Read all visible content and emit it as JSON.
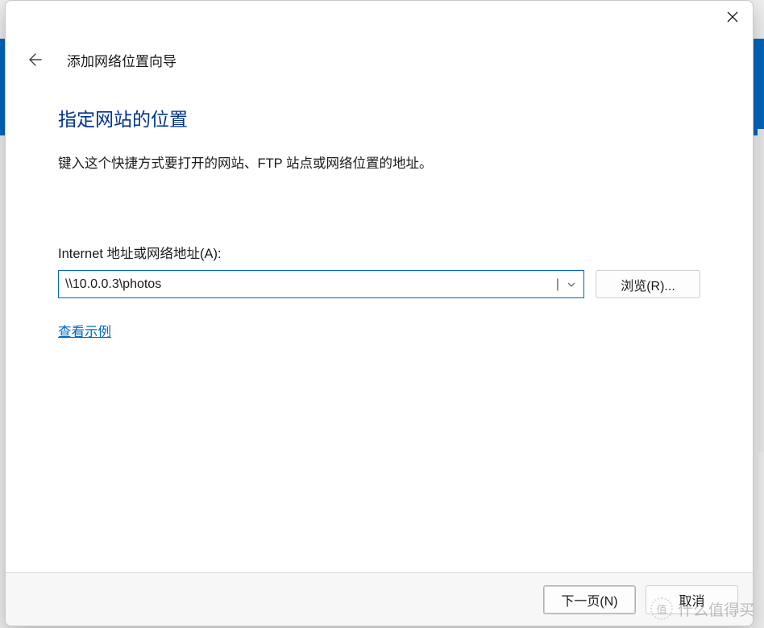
{
  "wizard": {
    "title": "添加网络位置向导",
    "heading": "指定网站的位置",
    "instruction": "键入这个快捷方式要打开的网站、FTP 站点或网络位置的地址。",
    "field_label": "Internet 地址或网络地址(A):",
    "address_value": "\\\\10.0.0.3\\photos",
    "browse_label": "浏览(R)...",
    "example_link": "查看示例"
  },
  "footer": {
    "next": "下一页(N)",
    "cancel": "取消"
  },
  "watermark": {
    "badge": "值",
    "text": "什么值得买"
  }
}
